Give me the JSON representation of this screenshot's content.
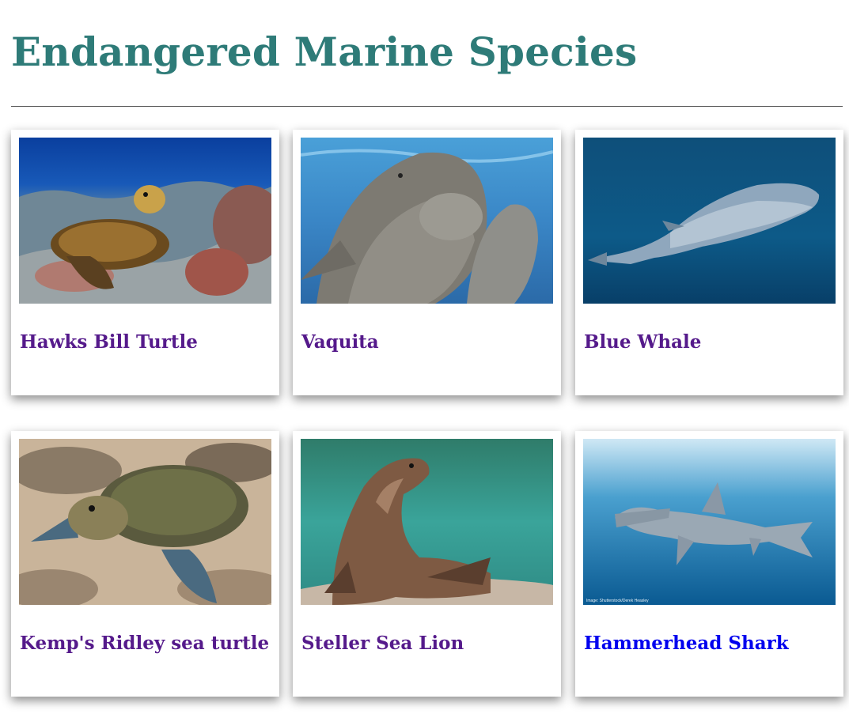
{
  "page": {
    "title": "Endangered Marine Species"
  },
  "colors": {
    "title": "#2e7b78",
    "visited_link": "#551a8b",
    "link": "#0000ee"
  },
  "species": [
    {
      "name": "Hawks Bill Turtle",
      "visited": true,
      "image": "hawksbill-turtle-photo"
    },
    {
      "name": "Vaquita",
      "visited": true,
      "image": "vaquita-photo"
    },
    {
      "name": "Blue Whale",
      "visited": true,
      "image": "blue-whale-photo"
    },
    {
      "name": "Kemp's Ridley sea turtle",
      "visited": true,
      "image": "kemps-ridley-turtle-photo"
    },
    {
      "name": "Steller Sea Lion",
      "visited": true,
      "image": "steller-sea-lion-photo"
    },
    {
      "name": "Hammerhead Shark",
      "visited": false,
      "image": "hammerhead-shark-photo",
      "credit": "Image: Shutterstock/Derek Heasley"
    }
  ]
}
